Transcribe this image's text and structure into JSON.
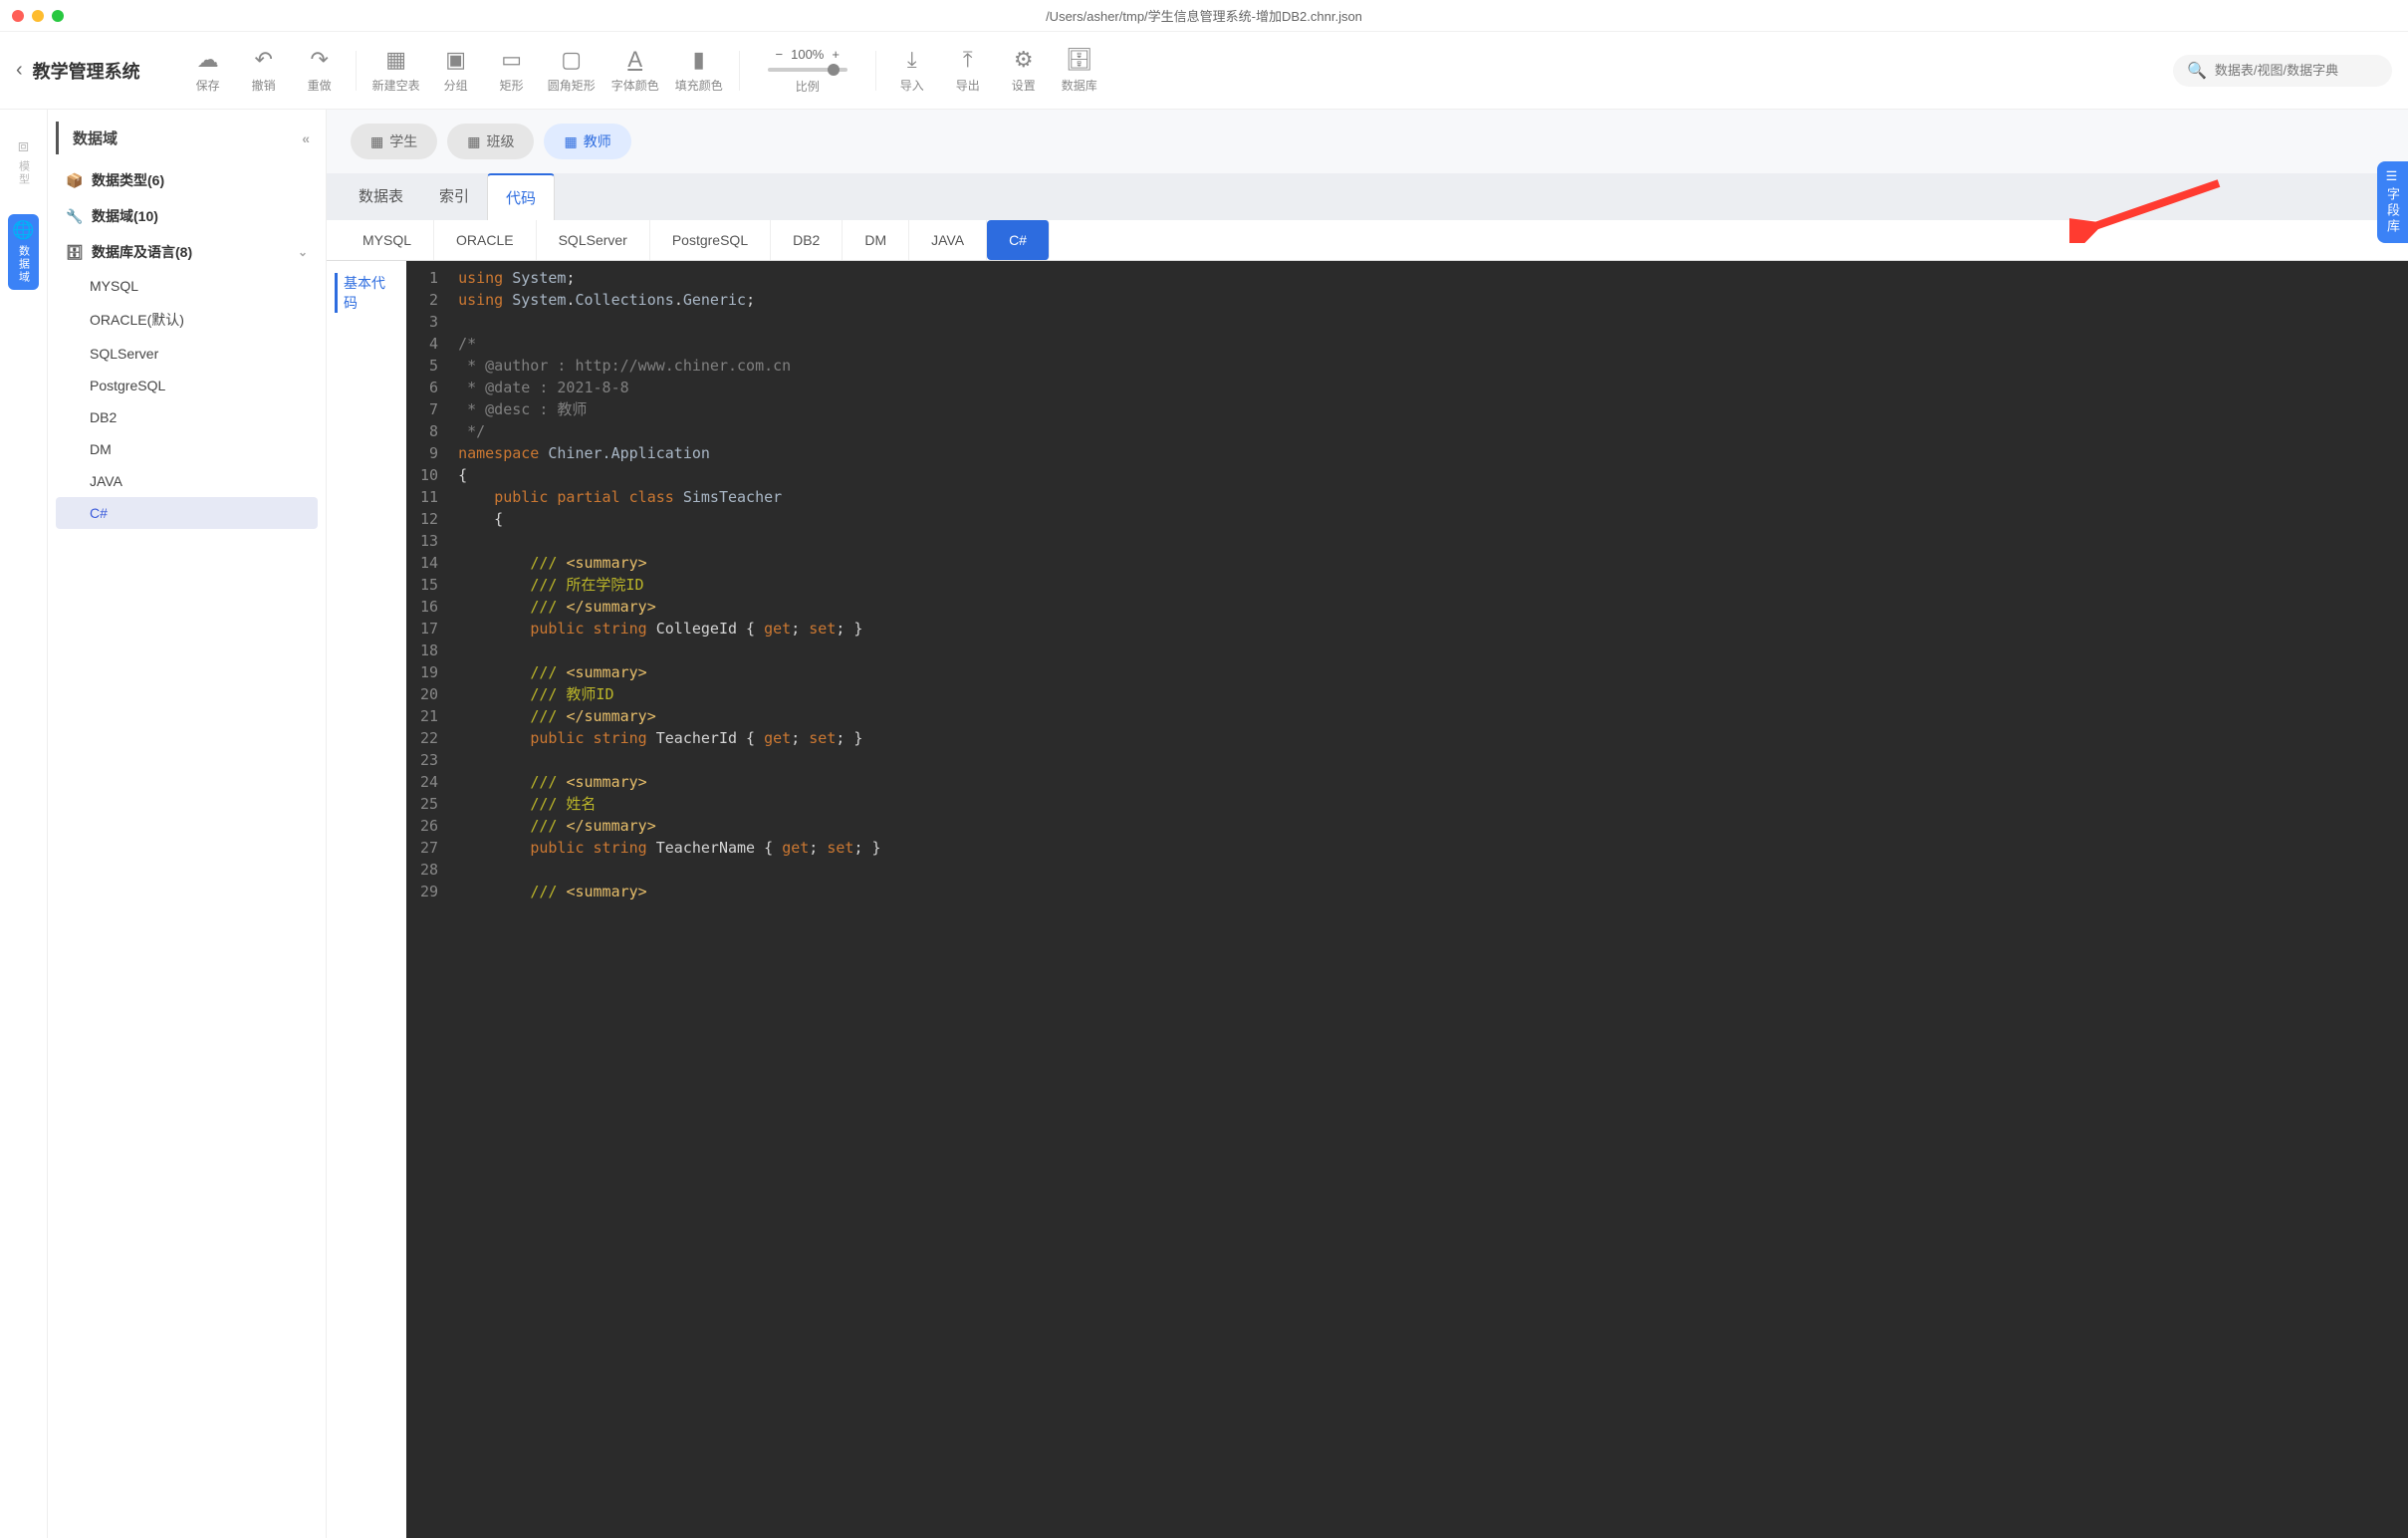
{
  "window": {
    "path": "/Users/asher/tmp/学生信息管理系统-增加DB2.chnr.json"
  },
  "header": {
    "app_title": "教学管理系统"
  },
  "toolbar": {
    "save": "保存",
    "undo": "撤销",
    "redo": "重做",
    "new_table": "新建空表",
    "group": "分组",
    "rect": "矩形",
    "rounded_rect": "圆角矩形",
    "font_color": "字体颜色",
    "fill_color": "填充颜色",
    "zoom_value": "100%",
    "zoom_label": "比例",
    "import": "导入",
    "export": "导出",
    "settings": "设置",
    "database": "数据库"
  },
  "search": {
    "placeholder": "数据表/视图/数据字典"
  },
  "vtabs": {
    "model": "模型",
    "domain": "数据域"
  },
  "sidebar": {
    "head": "数据域",
    "groups": {
      "datatype": "数据类型(6)",
      "domain": "数据域(10)",
      "db_lang": "数据库及语言(8)"
    },
    "db_lang_items": [
      "MYSQL",
      "ORACLE(默认)",
      "SQLServer",
      "PostgreSQL",
      "DB2",
      "DM",
      "JAVA",
      "C#"
    ]
  },
  "tabs": {
    "pills": {
      "student": "学生",
      "class": "班级",
      "teacher": "教师"
    },
    "sub": {
      "table": "数据表",
      "index": "索引",
      "code": "代码"
    },
    "langs": [
      "MYSQL",
      "ORACLE",
      "SQLServer",
      "PostgreSQL",
      "DB2",
      "DM",
      "JAVA",
      "C#"
    ]
  },
  "code_side": {
    "basic": "基本代码"
  },
  "right_handle": "字段库",
  "code": {
    "lines": [
      {
        "n": 1,
        "seg": [
          {
            "c": "kw",
            "t": "using"
          },
          {
            "c": "txt",
            "t": " "
          },
          {
            "c": "typ",
            "t": "System"
          },
          {
            "c": "txt",
            "t": ";"
          }
        ]
      },
      {
        "n": 2,
        "seg": [
          {
            "c": "kw",
            "t": "using"
          },
          {
            "c": "txt",
            "t": " "
          },
          {
            "c": "typ",
            "t": "System"
          },
          {
            "c": "txt",
            "t": "."
          },
          {
            "c": "typ",
            "t": "Collections"
          },
          {
            "c": "txt",
            "t": "."
          },
          {
            "c": "typ",
            "t": "Generic"
          },
          {
            "c": "txt",
            "t": ";"
          }
        ]
      },
      {
        "n": 3,
        "seg": []
      },
      {
        "n": 4,
        "seg": [
          {
            "c": "cmt",
            "t": "/*"
          }
        ]
      },
      {
        "n": 5,
        "seg": [
          {
            "c": "cmt",
            "t": " * @author : http://www.chiner.com.cn"
          }
        ]
      },
      {
        "n": 6,
        "seg": [
          {
            "c": "cmt",
            "t": " * @date : 2021-8-8"
          }
        ]
      },
      {
        "n": 7,
        "seg": [
          {
            "c": "cmt",
            "t": " * @desc : 教师"
          }
        ]
      },
      {
        "n": 8,
        "seg": [
          {
            "c": "cmt",
            "t": " */"
          }
        ]
      },
      {
        "n": 9,
        "seg": [
          {
            "c": "kw",
            "t": "namespace"
          },
          {
            "c": "txt",
            "t": " "
          },
          {
            "c": "typ",
            "t": "Chiner.Application"
          }
        ]
      },
      {
        "n": 10,
        "seg": [
          {
            "c": "txt",
            "t": "{"
          }
        ]
      },
      {
        "n": 11,
        "seg": [
          {
            "c": "txt",
            "t": "    "
          },
          {
            "c": "kw",
            "t": "public"
          },
          {
            "c": "txt",
            "t": " "
          },
          {
            "c": "kw",
            "t": "partial"
          },
          {
            "c": "txt",
            "t": " "
          },
          {
            "c": "kw",
            "t": "class"
          },
          {
            "c": "txt",
            "t": " "
          },
          {
            "c": "typ",
            "t": "SimsTeacher"
          }
        ]
      },
      {
        "n": 12,
        "seg": [
          {
            "c": "txt",
            "t": "    {"
          }
        ]
      },
      {
        "n": 13,
        "seg": []
      },
      {
        "n": 14,
        "seg": [
          {
            "c": "txt",
            "t": "        "
          },
          {
            "c": "doc",
            "t": "/// "
          },
          {
            "c": "tag",
            "t": "<summary>"
          }
        ]
      },
      {
        "n": 15,
        "seg": [
          {
            "c": "txt",
            "t": "        "
          },
          {
            "c": "doc",
            "t": "/// 所在学院ID"
          }
        ]
      },
      {
        "n": 16,
        "seg": [
          {
            "c": "txt",
            "t": "        "
          },
          {
            "c": "doc",
            "t": "/// "
          },
          {
            "c": "tag",
            "t": "</summary>"
          }
        ]
      },
      {
        "n": 17,
        "seg": [
          {
            "c": "txt",
            "t": "        "
          },
          {
            "c": "kw",
            "t": "public"
          },
          {
            "c": "txt",
            "t": " "
          },
          {
            "c": "kw",
            "t": "string"
          },
          {
            "c": "txt",
            "t": " CollegeId { "
          },
          {
            "c": "kw",
            "t": "get"
          },
          {
            "c": "txt",
            "t": "; "
          },
          {
            "c": "kw",
            "t": "set"
          },
          {
            "c": "txt",
            "t": "; }"
          }
        ]
      },
      {
        "n": 18,
        "seg": []
      },
      {
        "n": 19,
        "seg": [
          {
            "c": "txt",
            "t": "        "
          },
          {
            "c": "doc",
            "t": "/// "
          },
          {
            "c": "tag",
            "t": "<summary>"
          }
        ]
      },
      {
        "n": 20,
        "seg": [
          {
            "c": "txt",
            "t": "        "
          },
          {
            "c": "doc",
            "t": "/// 教师ID"
          }
        ]
      },
      {
        "n": 21,
        "seg": [
          {
            "c": "txt",
            "t": "        "
          },
          {
            "c": "doc",
            "t": "/// "
          },
          {
            "c": "tag",
            "t": "</summary>"
          }
        ]
      },
      {
        "n": 22,
        "seg": [
          {
            "c": "txt",
            "t": "        "
          },
          {
            "c": "kw",
            "t": "public"
          },
          {
            "c": "txt",
            "t": " "
          },
          {
            "c": "kw",
            "t": "string"
          },
          {
            "c": "txt",
            "t": " TeacherId { "
          },
          {
            "c": "kw",
            "t": "get"
          },
          {
            "c": "txt",
            "t": "; "
          },
          {
            "c": "kw",
            "t": "set"
          },
          {
            "c": "txt",
            "t": "; }"
          }
        ]
      },
      {
        "n": 23,
        "seg": []
      },
      {
        "n": 24,
        "seg": [
          {
            "c": "txt",
            "t": "        "
          },
          {
            "c": "doc",
            "t": "/// "
          },
          {
            "c": "tag",
            "t": "<summary>"
          }
        ]
      },
      {
        "n": 25,
        "seg": [
          {
            "c": "txt",
            "t": "        "
          },
          {
            "c": "doc",
            "t": "/// 姓名"
          }
        ]
      },
      {
        "n": 26,
        "seg": [
          {
            "c": "txt",
            "t": "        "
          },
          {
            "c": "doc",
            "t": "/// "
          },
          {
            "c": "tag",
            "t": "</summary>"
          }
        ]
      },
      {
        "n": 27,
        "seg": [
          {
            "c": "txt",
            "t": "        "
          },
          {
            "c": "kw",
            "t": "public"
          },
          {
            "c": "txt",
            "t": " "
          },
          {
            "c": "kw",
            "t": "string"
          },
          {
            "c": "txt",
            "t": " TeacherName { "
          },
          {
            "c": "kw",
            "t": "get"
          },
          {
            "c": "txt",
            "t": "; "
          },
          {
            "c": "kw",
            "t": "set"
          },
          {
            "c": "txt",
            "t": "; }"
          }
        ]
      },
      {
        "n": 28,
        "seg": []
      },
      {
        "n": 29,
        "seg": [
          {
            "c": "txt",
            "t": "        "
          },
          {
            "c": "doc",
            "t": "/// "
          },
          {
            "c": "tag",
            "t": "<summary>"
          }
        ]
      }
    ]
  }
}
